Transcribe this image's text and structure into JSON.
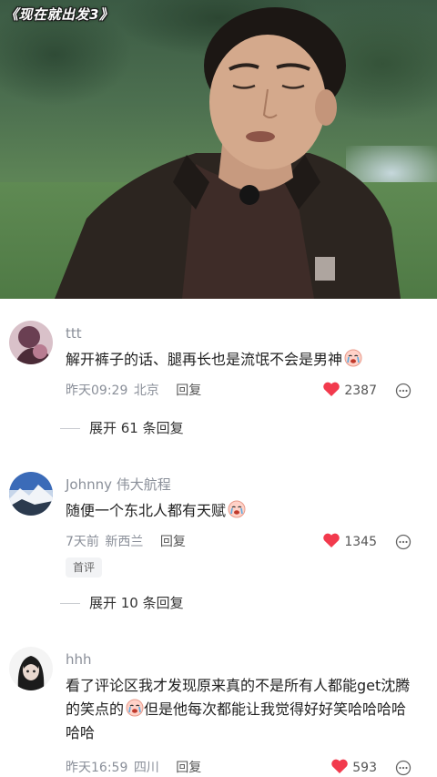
{
  "video": {
    "show_title": "《现在就出发3》"
  },
  "comments": [
    {
      "username": "ttt",
      "text": "解开裤子的话、腿再长也是流氓不会是男神",
      "emoji": "crying-face-emoji",
      "time": "昨天09:29",
      "location": "北京",
      "reply_label": "回复",
      "likes": "2387",
      "liked": true,
      "expand_label": "展开 61 条回复"
    },
    {
      "username": "Johnny 伟大航程",
      "text": "随便一个东北人都有天赋",
      "emoji": "crying-face-emoji",
      "time": "7天前",
      "location": "新西兰",
      "reply_label": "回复",
      "likes": "1345",
      "liked": true,
      "badge": "首评",
      "expand_label": "展开 10 条回复"
    },
    {
      "username": "hhh",
      "text_part1": "看了评论区我才发现原来真的不是所有人都能get沈腾的笑点的",
      "emoji": "crying-face-emoji",
      "text_part2": "但是他每次都能让我觉得好好笑哈哈哈哈哈哈",
      "time": "昨天16:59",
      "location": "四川",
      "reply_label": "回复",
      "likes": "593",
      "liked": true
    }
  ],
  "colors": {
    "heart": "#f23a4d",
    "muted_text": "#8a8f99"
  }
}
